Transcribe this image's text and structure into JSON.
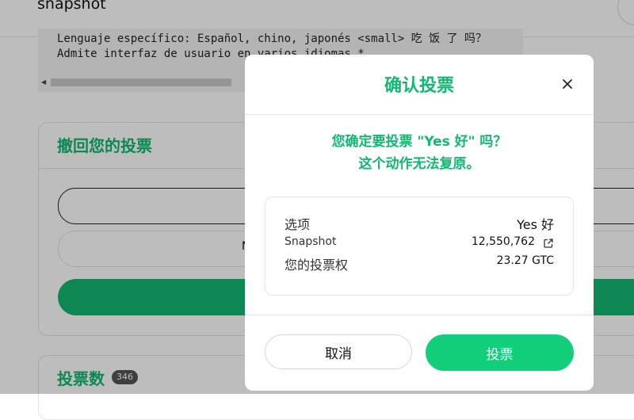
{
  "header": {
    "brand": "snapshot"
  },
  "code_block": {
    "line1": "Lenguaje específico: Español, chino, japonés <small> 吃 饭 了 吗？",
    "line2": "Admite interfaz de usuario en varios idiomas *"
  },
  "retract_card": {
    "title": "撤回您的投票",
    "field_text": "N"
  },
  "votes_card": {
    "title": "投票数",
    "count": "346"
  },
  "modal": {
    "title": "确认投票",
    "confirm_line1": "您确定要投票 \"Yes 好\" 吗？",
    "confirm_line2": "这个动作无法复原。",
    "rows": [
      {
        "label": "选项",
        "value": "Yes 好"
      },
      {
        "label": "Snapshot",
        "value": "12,550,762"
      },
      {
        "label": "您的投票权",
        "value": "23.27 GTC"
      }
    ],
    "cancel_label": "取消",
    "vote_label": "投票"
  },
  "colors": {
    "accent": "#12b871",
    "vote_button": "#12cf7b"
  },
  "icons": {
    "close": "close-icon",
    "external_link": "external-link-icon"
  }
}
